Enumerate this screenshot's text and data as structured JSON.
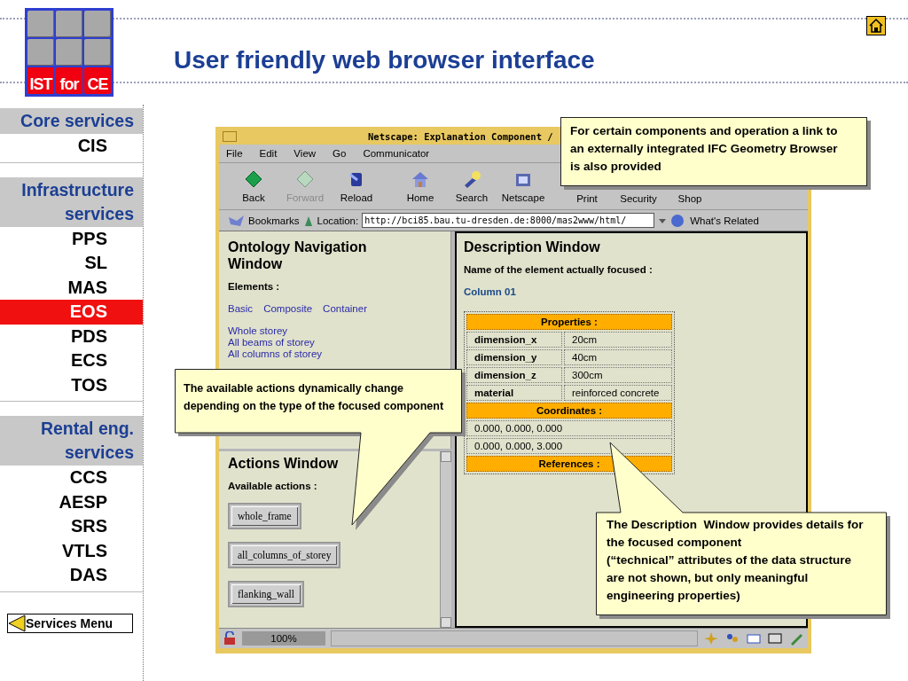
{
  "header": {
    "logo_text": [
      "IST",
      "for",
      "CE"
    ],
    "title": "User friendly web browser interface"
  },
  "sidebar": {
    "sections": [
      {
        "heading": "Core services",
        "items": [
          {
            "label": "CIS",
            "selected": false
          }
        ]
      },
      {
        "heading": "Infrastructure services",
        "items": [
          {
            "label": "PPS",
            "selected": false
          },
          {
            "label": "SL",
            "selected": false
          },
          {
            "label": "MAS",
            "selected": false
          },
          {
            "label": "EOS",
            "selected": true
          },
          {
            "label": "PDS",
            "selected": false
          },
          {
            "label": "ECS",
            "selected": false
          },
          {
            "label": "TOS",
            "selected": false
          }
        ]
      },
      {
        "heading": "Rental eng. services",
        "items": [
          {
            "label": "CCS",
            "selected": false
          },
          {
            "label": "AESP",
            "selected": false
          },
          {
            "label": "SRS",
            "selected": false
          },
          {
            "label": "VTLS",
            "selected": false
          },
          {
            "label": "DAS",
            "selected": false
          }
        ]
      }
    ],
    "menu_button": "Services Menu"
  },
  "browser": {
    "title": "Netscape: Explanation Component /",
    "menu": [
      "File",
      "Edit",
      "View",
      "Go",
      "Communicator"
    ],
    "toolbar": [
      {
        "label": "Back",
        "kind": "back",
        "disabled": false
      },
      {
        "label": "Forward",
        "kind": "forward",
        "disabled": true
      },
      {
        "label": "Reload",
        "kind": "reload",
        "disabled": false
      },
      {
        "label": "Home",
        "kind": "home",
        "disabled": false
      },
      {
        "label": "Search",
        "kind": "search",
        "disabled": false
      },
      {
        "label": "Netscape",
        "kind": "netscape",
        "disabled": false
      },
      {
        "label": "Print",
        "kind": "covered",
        "disabled": false
      },
      {
        "label": "Security",
        "kind": "covered",
        "disabled": false
      },
      {
        "label": "Shop",
        "kind": "covered",
        "disabled": false
      }
    ],
    "bookmarks": "Bookmarks",
    "location_label": "Location:",
    "url": "http://bci85.bau.tu-dresden.de:8000/mas2www/html/",
    "whats_related": "What's Related",
    "navigation": {
      "title": "Ontology Navigation Window",
      "elements_label": "Elements :",
      "categories": [
        "Basic",
        "Composite",
        "Container"
      ],
      "links": [
        "Whole storey",
        "All beams of storey",
        "All columns of storey"
      ]
    },
    "actions": {
      "title": "Actions Window",
      "label": "Available actions :",
      "buttons": [
        "whole_frame",
        "all_columns_of_storey",
        "flanking_wall"
      ]
    },
    "description": {
      "title": "Description Window",
      "focused_label": "Name of the element actually focused :",
      "focused_value": "Column 01",
      "table": [
        {
          "kind": "heading",
          "text": "Properties :"
        },
        {
          "kind": "pair",
          "name": "dimension_x",
          "value": "20cm"
        },
        {
          "kind": "pair",
          "name": "dimension_y",
          "value": "40cm"
        },
        {
          "kind": "pair",
          "name": "dimension_z",
          "value": "300cm"
        },
        {
          "kind": "pair",
          "name": "material",
          "value": "reinforced concrete"
        },
        {
          "kind": "heading",
          "text": "Coordinates :"
        },
        {
          "kind": "value",
          "text": "0.000, 0.000, 0.000"
        },
        {
          "kind": "value",
          "text": "0.000, 0.000, 3.000"
        },
        {
          "kind": "heading",
          "text": "References :"
        }
      ]
    },
    "status": {
      "zoom": "100%"
    }
  },
  "callouts": [
    {
      "kind": "plain",
      "text": "For certain components and operation a link to\nan externally integrated IFC Geometry Browser\nis also provided"
    },
    {
      "kind": "down",
      "text": "The available actions dynamically change\ndepending on the type of the focused component"
    },
    {
      "kind": "up",
      "text": "The Description  Window provides details for\nthe focused component\n(“technical” attributes of the data structure\nare not shown, but only meaningful\nengineering properties)"
    }
  ]
}
